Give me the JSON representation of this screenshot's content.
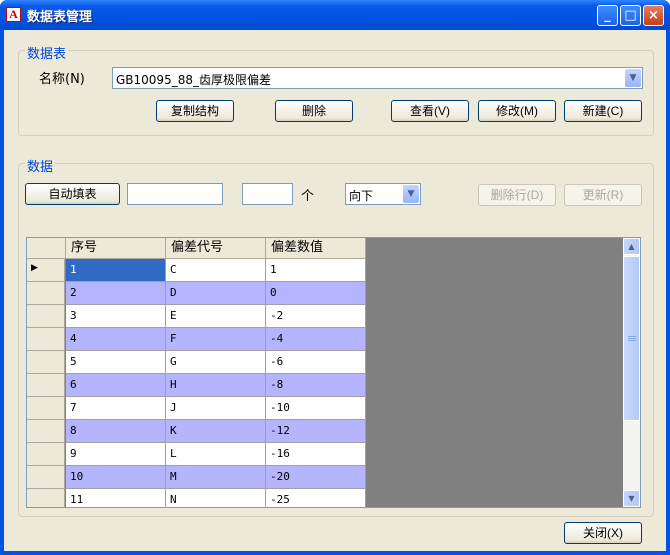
{
  "window": {
    "title": "数据表管理",
    "app_icon_letter": "A"
  },
  "table_group": {
    "title": "数据表",
    "name_label": "名称(N)",
    "name_value": "GB10095_88_齿厚极限偏差",
    "buttons": {
      "copy": "复制结构",
      "delete": "删除",
      "view": "查看(V)",
      "modify": "修改(M)",
      "new": "新建(C)"
    }
  },
  "data_group": {
    "title": "数据",
    "autofill_label": "自动填表",
    "fill_value": "",
    "count_value": "",
    "count_unit": "个",
    "direction_value": "向下",
    "delete_row_label": "删除行(D)",
    "update_label": "更新(R)"
  },
  "grid": {
    "columns": [
      "序号",
      "偏差代号",
      "偏差数值"
    ],
    "rows": [
      [
        "1",
        "C",
        "1"
      ],
      [
        "2",
        "D",
        "0"
      ],
      [
        "3",
        "E",
        "-2"
      ],
      [
        "4",
        "F",
        "-4"
      ],
      [
        "5",
        "G",
        "-6"
      ],
      [
        "6",
        "H",
        "-8"
      ],
      [
        "7",
        "J",
        "-10"
      ],
      [
        "8",
        "K",
        "-12"
      ],
      [
        "9",
        "L",
        "-16"
      ],
      [
        "10",
        "M",
        "-20"
      ],
      [
        "11",
        "N",
        "-25"
      ]
    ],
    "row_alt_color": "#b4b4ff",
    "selected_color": "#316ac5"
  },
  "footer": {
    "close_label": "关闭(X)"
  }
}
